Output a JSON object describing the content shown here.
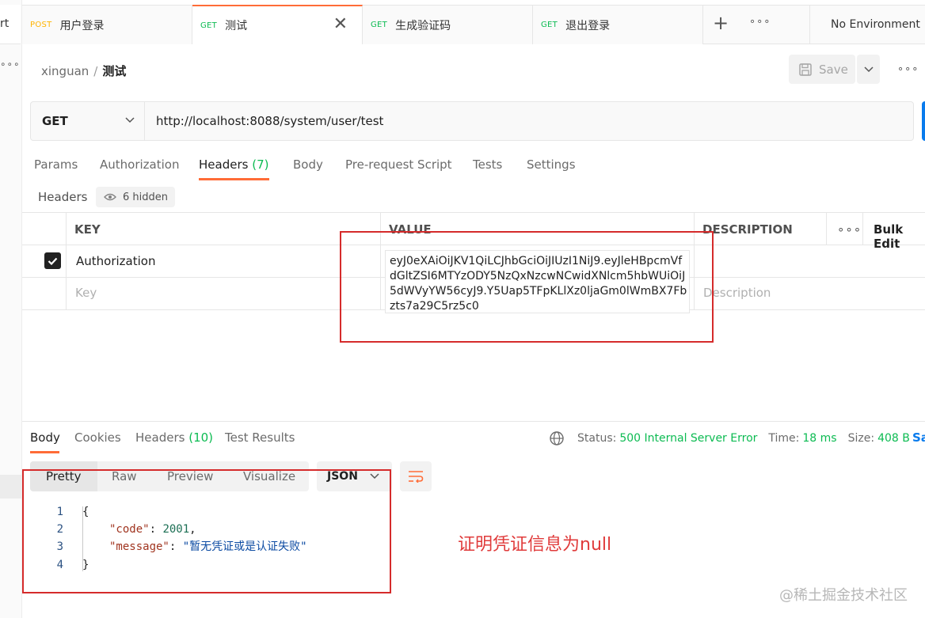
{
  "left_strip": {
    "fragment": "rt"
  },
  "tabs": [
    {
      "method": "POST",
      "name": "用户登录"
    },
    {
      "method": "GET",
      "name": "测试",
      "active": true
    },
    {
      "method": "GET",
      "name": "生成验证码"
    },
    {
      "method": "GET",
      "name": "退出登录"
    }
  ],
  "environment": "No Environment",
  "breadcrumb": {
    "workspace": "xinguan",
    "separator": "/",
    "current": "测试"
  },
  "toolbar": {
    "save_label": "Save"
  },
  "request": {
    "method": "GET",
    "url": "http://localhost:8088/system/user/test"
  },
  "request_tabs": {
    "params": "Params",
    "authorization": "Authorization",
    "headers": "Headers",
    "headers_count": "(7)",
    "body": "Body",
    "prerequest": "Pre-request Script",
    "tests": "Tests",
    "settings": "Settings"
  },
  "headers_section": {
    "label": "Headers",
    "hidden": "6 hidden"
  },
  "headers_table": {
    "columns": {
      "key": "KEY",
      "value": "VALUE",
      "description": "DESCRIPTION",
      "bulk_edit": "Bulk Edit"
    },
    "rows": [
      {
        "key": "Authorization",
        "value": "eyJ0eXAiOiJKV1QiLCJhbGciOiJIUzI1NiJ9.eyJleHBpcmVfdGltZSI6MTYzODY5NzQxNzcwNCwidXNlcm5hbWUiOiJ5dWVyYW56cyJ9.Y5Uap5TFpKLlXz0ljaGm0lWmBX7Fbzts7a29C5rz5c0",
        "checked": true
      }
    ],
    "placeholders": {
      "key": "Key",
      "description": "Description"
    }
  },
  "response": {
    "tabs": {
      "body": "Body",
      "cookies": "Cookies",
      "headers": "Headers",
      "headers_count": "(10)",
      "test_results": "Test Results"
    },
    "status_label": "Status:",
    "status_value": "500 Internal Server Error",
    "time_label": "Time:",
    "time_value": "18 ms",
    "size_label": "Size:",
    "size_value": "408 B",
    "save_fragment": "Sa",
    "view_modes": {
      "pretty": "Pretty",
      "raw": "Raw",
      "preview": "Preview",
      "visualize": "Visualize"
    },
    "format": "JSON",
    "code_lines": {
      "n1": "1",
      "n2": "2",
      "n3": "3",
      "n4": "4",
      "open": "{",
      "k_code": "\"code\"",
      "v_code": "2001",
      "k_message": "\"message\"",
      "v_message": "\"暂无凭证或是认证失败\"",
      "close": "}"
    }
  },
  "annotation": "证明凭证信息为null",
  "watermark": "@稀土掘金技术社区",
  "colors": {
    "accent": "#ff6c37",
    "get": "#0cbb52",
    "post": "#ffb400",
    "annotation": "#d52b2b",
    "link": "#097bed"
  }
}
